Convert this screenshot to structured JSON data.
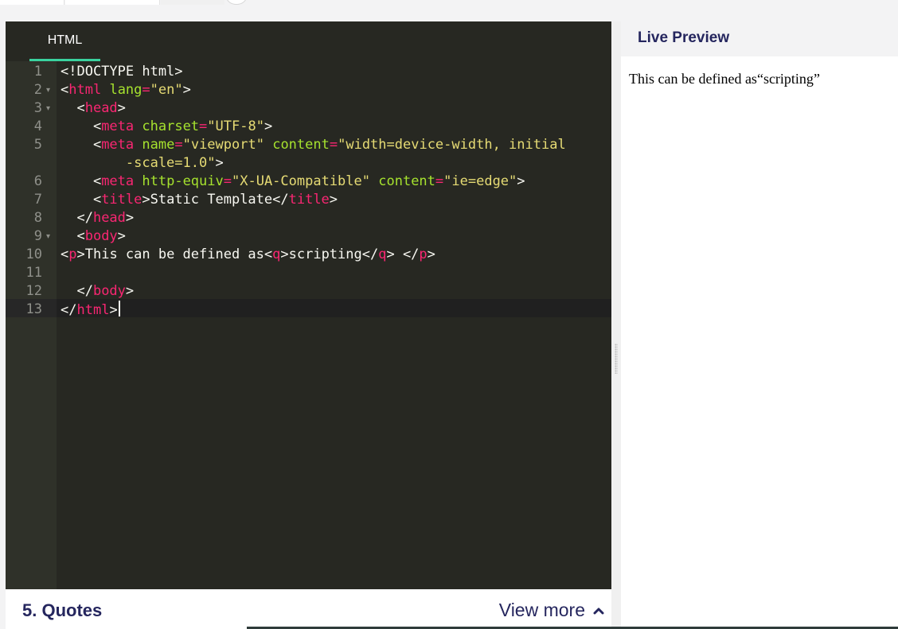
{
  "editor": {
    "tab_label": "HTML",
    "accent": "#3ad29f",
    "lines": [
      {
        "n": "1",
        "fold": false,
        "tokens": [
          [
            "p",
            "<!DOCTYPE html>"
          ]
        ]
      },
      {
        "n": "2",
        "fold": true,
        "tokens": [
          [
            "p",
            "<"
          ],
          [
            "t",
            "html"
          ],
          [
            "p",
            " "
          ],
          [
            "a",
            "lang"
          ],
          [
            "t",
            "="
          ],
          [
            "s",
            "\"en\""
          ],
          [
            "p",
            ">"
          ]
        ]
      },
      {
        "n": "3",
        "fold": true,
        "tokens": [
          [
            "p",
            "  <"
          ],
          [
            "t",
            "head"
          ],
          [
            "p",
            ">"
          ]
        ]
      },
      {
        "n": "4",
        "fold": false,
        "tokens": [
          [
            "p",
            "    <"
          ],
          [
            "t",
            "meta"
          ],
          [
            "p",
            " "
          ],
          [
            "a",
            "charset"
          ],
          [
            "t",
            "="
          ],
          [
            "s",
            "\"UTF-8\""
          ],
          [
            "p",
            ">"
          ]
        ]
      },
      {
        "n": "5",
        "fold": false,
        "wrapped": true,
        "tokens": [
          [
            "p",
            "    <"
          ],
          [
            "t",
            "meta"
          ],
          [
            "p",
            " "
          ],
          [
            "a",
            "name"
          ],
          [
            "t",
            "="
          ],
          [
            "s",
            "\"viewport\""
          ],
          [
            "p",
            " "
          ],
          [
            "a",
            "content"
          ],
          [
            "t",
            "="
          ],
          [
            "s",
            "\"width=device-width, initial\n        -scale=1.0\""
          ],
          [
            "p",
            ">"
          ]
        ]
      },
      {
        "n": "6",
        "fold": false,
        "tokens": [
          [
            "p",
            "    <"
          ],
          [
            "t",
            "meta"
          ],
          [
            "p",
            " "
          ],
          [
            "a",
            "http-equiv"
          ],
          [
            "t",
            "="
          ],
          [
            "s",
            "\"X-UA-Compatible\""
          ],
          [
            "p",
            " "
          ],
          [
            "a",
            "content"
          ],
          [
            "t",
            "="
          ],
          [
            "s",
            "\"ie=edge\""
          ],
          [
            "p",
            ">"
          ]
        ]
      },
      {
        "n": "7",
        "fold": false,
        "tokens": [
          [
            "p",
            "    <"
          ],
          [
            "t",
            "title"
          ],
          [
            "p",
            ">Static Template</"
          ],
          [
            "t",
            "title"
          ],
          [
            "p",
            ">"
          ]
        ]
      },
      {
        "n": "8",
        "fold": false,
        "tokens": [
          [
            "p",
            "  </"
          ],
          [
            "t",
            "head"
          ],
          [
            "p",
            ">"
          ]
        ]
      },
      {
        "n": "9",
        "fold": true,
        "tokens": [
          [
            "p",
            "  <"
          ],
          [
            "t",
            "body"
          ],
          [
            "p",
            ">"
          ]
        ]
      },
      {
        "n": "10",
        "fold": false,
        "tokens": [
          [
            "p",
            "<"
          ],
          [
            "t",
            "p"
          ],
          [
            "p",
            ">This can be defined as<"
          ],
          [
            "t",
            "q"
          ],
          [
            "p",
            ">scripting</"
          ],
          [
            "t",
            "q"
          ],
          [
            "p",
            "> </"
          ],
          [
            "t",
            "p"
          ],
          [
            "p",
            ">"
          ]
        ]
      },
      {
        "n": "11",
        "fold": false,
        "tokens": []
      },
      {
        "n": "12",
        "fold": false,
        "tokens": [
          [
            "p",
            "  </"
          ],
          [
            "t",
            "body"
          ],
          [
            "p",
            ">"
          ]
        ]
      },
      {
        "n": "13",
        "fold": false,
        "active": true,
        "cursor": true,
        "tokens": [
          [
            "p",
            "</"
          ],
          [
            "t",
            "html"
          ],
          [
            "p",
            ">"
          ]
        ]
      }
    ]
  },
  "preview": {
    "title": "Live Preview",
    "text_before": "This can be defined as",
    "quote": "scripting"
  },
  "footer": {
    "title": "5. Quotes",
    "more_label": "View more",
    "more_icon": "chevron-up-icon"
  }
}
